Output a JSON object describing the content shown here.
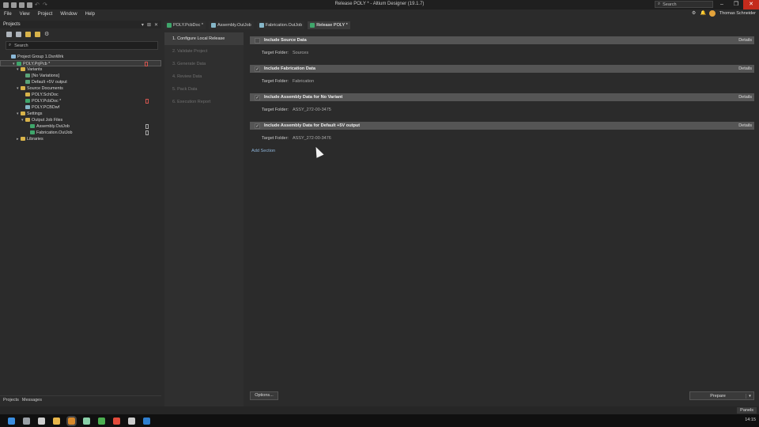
{
  "window": {
    "title": "Release POLY * - Altium Designer (19.1.7)",
    "search_placeholder": "Search",
    "user_name": "Thomas Schneider"
  },
  "menu": [
    "File",
    "View",
    "Project",
    "Window",
    "Help"
  ],
  "projects_panel": {
    "title": "Projects",
    "search_placeholder": "Search",
    "tree": [
      {
        "label": "Project Group 1.DsnWrk",
        "indent": 0,
        "icon": "grp",
        "arrow": ""
      },
      {
        "label": "POLY.PrjPcb *",
        "indent": 1,
        "icon": "pcb",
        "arrow": "▾",
        "selected": true,
        "mark": "red"
      },
      {
        "label": "Variants",
        "indent": 2,
        "icon": "folder",
        "arrow": "▾"
      },
      {
        "label": "[No Variations]",
        "indent": 3,
        "icon": "var",
        "arrow": ""
      },
      {
        "label": "Default +5V output",
        "indent": 3,
        "icon": "var",
        "arrow": ""
      },
      {
        "label": "Source Documents",
        "indent": 2,
        "icon": "folder",
        "arrow": "▾"
      },
      {
        "label": "POLY.SchDoc",
        "indent": 3,
        "icon": "folder",
        "arrow": ""
      },
      {
        "label": "POLY.PcbDoc *",
        "indent": 3,
        "icon": "pcb",
        "arrow": "",
        "mark": "red"
      },
      {
        "label": "POLY.PCBDwf",
        "indent": 3,
        "icon": "doc",
        "arrow": ""
      },
      {
        "label": "Settings",
        "indent": 2,
        "icon": "folder",
        "arrow": "▾"
      },
      {
        "label": "Output Job Files",
        "indent": 3,
        "icon": "folder",
        "arrow": "▾"
      },
      {
        "label": "Assembly.OutJob",
        "indent": 4,
        "icon": "pcb",
        "arrow": "",
        "mark": "plain"
      },
      {
        "label": "Fabrication.OutJob",
        "indent": 4,
        "icon": "pcb",
        "arrow": "",
        "mark": "plain"
      },
      {
        "label": "Libraries",
        "indent": 2,
        "icon": "folder",
        "arrow": "▸"
      }
    ],
    "bottom_tabs": [
      "Projects",
      "Messages"
    ]
  },
  "doc_tabs": [
    {
      "label": "POLY.PcbDoc *",
      "color": "#3fa66b",
      "active": false
    },
    {
      "label": "Assembly.OutJob",
      "color": "#86b7c9",
      "active": false
    },
    {
      "label": "Fabrication.OutJob",
      "color": "#86b7c9",
      "active": false
    },
    {
      "label": "Release POLY *",
      "color": "#3fa66b",
      "active": true
    }
  ],
  "steps": [
    {
      "label": "1. Configure Local Release",
      "active": true
    },
    {
      "label": "2. Validate Project",
      "active": false
    },
    {
      "label": "3. Generate Data",
      "active": false
    },
    {
      "label": "4. Review Data",
      "active": false
    },
    {
      "label": "5. Pack Data",
      "active": false
    },
    {
      "label": "6. Execution Report",
      "active": false
    }
  ],
  "sections": [
    {
      "title": "Include Source Data",
      "checked": false,
      "details": "Details",
      "target_label": "Target Folder:",
      "target_value": "Sources"
    },
    {
      "title": "Include Fabrication Data",
      "checked": true,
      "details": "Details",
      "target_label": "Target Folder:",
      "target_value": "Fabrication"
    },
    {
      "title": "Include Assembly Data for No Variant",
      "checked": true,
      "details": "Details",
      "target_label": "Target Folder:",
      "target_value": "ASSY_272-00-3475"
    },
    {
      "title": "Include Assembly Data for Default +5V output",
      "checked": true,
      "details": "Details",
      "target_label": "Target Folder:",
      "target_value": "ASSY_272-00-3476"
    }
  ],
  "add_section": "Add Section",
  "buttons": {
    "options": "Options...",
    "prepare": "Prepare"
  },
  "status": {
    "panels": "Panels"
  },
  "taskbar": {
    "clock": "14:15",
    "icons": [
      "#3b8ee0",
      "#9aa0a6",
      "#cfcfcf",
      "#e8b64a",
      "#d98a2b",
      "#8ad0a8",
      "#4caf50",
      "#e24b3b",
      "#cccccc",
      "#2f7fd0"
    ]
  },
  "colors": {
    "accent_link": "#8db3d8",
    "close": "#c42b1c"
  }
}
